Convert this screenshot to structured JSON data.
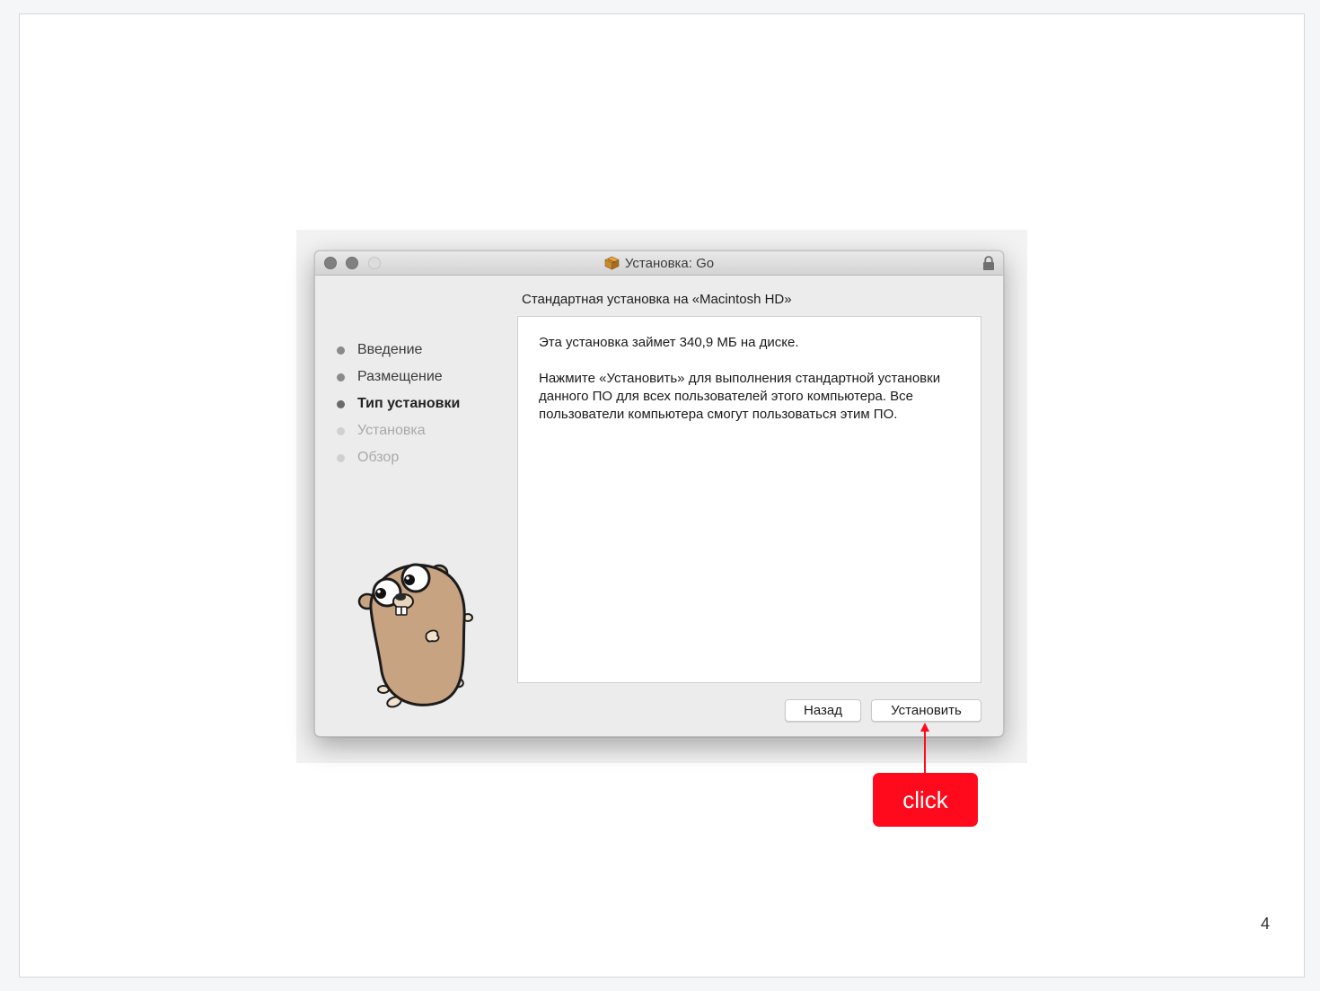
{
  "window": {
    "title": "Установка: Go",
    "subtitle": "Стандартная установка на «Macintosh HD»"
  },
  "steps": [
    {
      "label": "Введение",
      "state": "done"
    },
    {
      "label": "Размещение",
      "state": "done"
    },
    {
      "label": "Тип установки",
      "state": "current"
    },
    {
      "label": "Установка",
      "state": "pending"
    },
    {
      "label": "Обзор",
      "state": "pending"
    }
  ],
  "content": {
    "size_line": "Эта установка займет 340,9 МБ на диске.",
    "description": "Нажмите «Установить» для выполнения стандартной установки данного ПО для всех пользователей этого компьютера. Все пользователи компьютера смогут пользоваться этим ПО."
  },
  "buttons": {
    "back_label": "Назад",
    "install_label": "Установить"
  },
  "annotation": {
    "callout_label": "click",
    "color": "#ff0a1c"
  },
  "slide": {
    "page_number": "4"
  }
}
